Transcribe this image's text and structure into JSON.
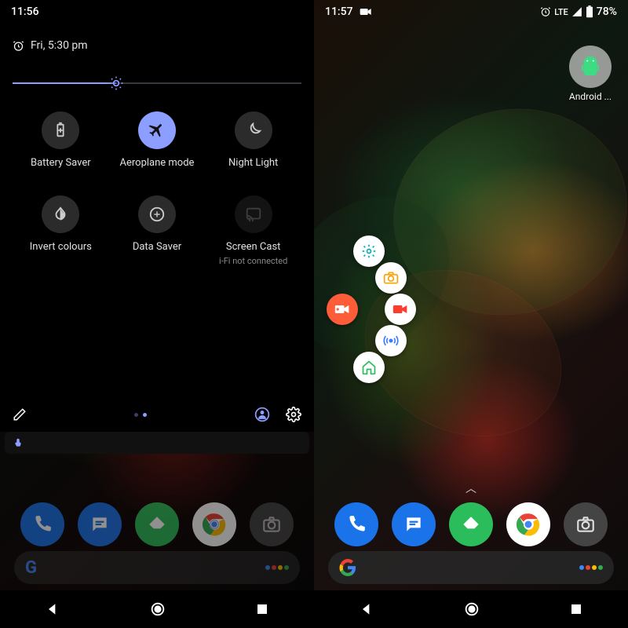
{
  "left": {
    "status_time": "11:56",
    "date_line": "Fri, 5:30 pm",
    "brightness_percent": 36,
    "tiles": [
      {
        "id": "battery-saver",
        "label": "Battery Saver",
        "icon": "battery-saver",
        "state": "off"
      },
      {
        "id": "airplane",
        "label": "Aeroplane mode",
        "icon": "airplane",
        "state": "on"
      },
      {
        "id": "night-light",
        "label": "Night Light",
        "icon": "moon",
        "state": "off"
      },
      {
        "id": "invert",
        "label": "Invert colours",
        "icon": "invert",
        "state": "off"
      },
      {
        "id": "data-saver",
        "label": "Data Saver",
        "icon": "data-saver",
        "state": "off"
      },
      {
        "id": "cast",
        "label": "Screen Cast",
        "icon": "cast",
        "state": "disabled",
        "sub": "i-Fi not connected"
      }
    ],
    "page_indicator": {
      "count": 2,
      "active": 1
    }
  },
  "right": {
    "status_time": "11:57",
    "status_network": "LTE",
    "status_battery": "78%",
    "home_app_label": "Android ...",
    "radial": {
      "main": "record",
      "items": [
        {
          "id": "settings",
          "icon": "gear",
          "color": "#00b2b2"
        },
        {
          "id": "camera",
          "icon": "camera",
          "color": "#ffa200"
        },
        {
          "id": "video",
          "icon": "video",
          "color": "#ff3b30"
        },
        {
          "id": "broadcast",
          "icon": "broadcast",
          "color": "#3a7cff"
        },
        {
          "id": "home",
          "icon": "home",
          "color": "#2bbd5c"
        }
      ]
    }
  },
  "dock_apps": [
    {
      "id": "phone",
      "name": "Phone"
    },
    {
      "id": "messages",
      "name": "Messages"
    },
    {
      "id": "feedly",
      "name": "Feedly"
    },
    {
      "id": "chrome",
      "name": "Chrome"
    },
    {
      "id": "camera",
      "name": "Camera"
    }
  ]
}
